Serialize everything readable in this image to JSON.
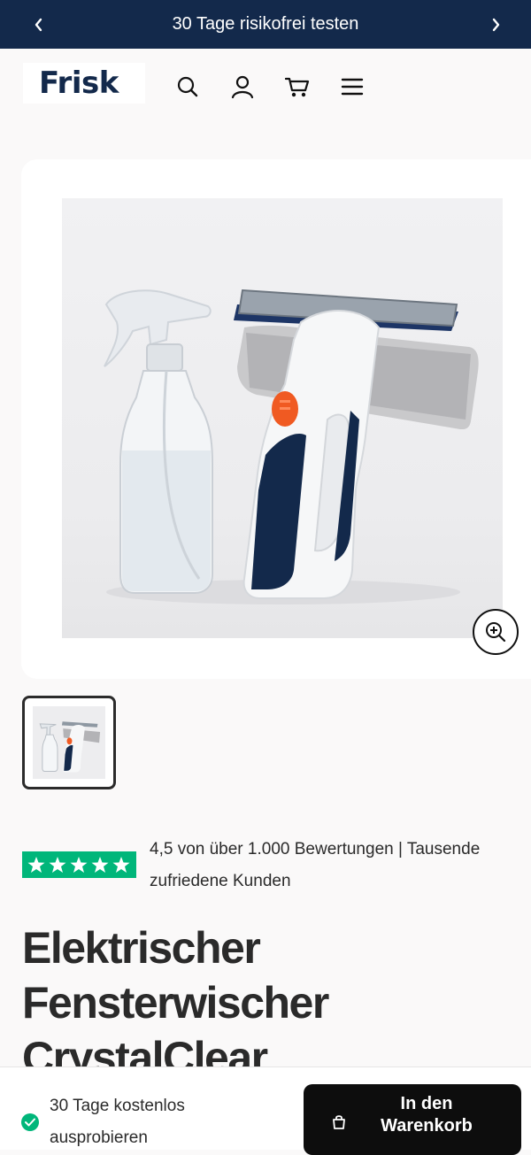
{
  "announcement": {
    "text": "30 Tage risikofrei testen",
    "prev_icon": "chevron-left-icon",
    "next_icon": "chevron-right-icon"
  },
  "header": {
    "logo_text": "Frisk",
    "icons": [
      "search-icon",
      "account-icon",
      "cart-icon",
      "menu-icon"
    ]
  },
  "gallery": {
    "zoom_icon": "zoom-in-icon",
    "thumbnail_count": 1
  },
  "rating": {
    "stars": 5,
    "text": "4,5 von über 1.000 Bewertungen | Tausende zufriedene Kunden"
  },
  "product": {
    "title": "Elektrischer Fensterwischer CrystalClear"
  },
  "sticky_bar": {
    "trial_text": "30 Tage kostenlos ausprobieren",
    "add_to_cart_label": "In den Warenkorb"
  },
  "colors": {
    "navy": "#13294b",
    "accent_orange": "#f05a22",
    "trustpilot_green": "#00b67a",
    "button_black": "#0d0d0d"
  }
}
